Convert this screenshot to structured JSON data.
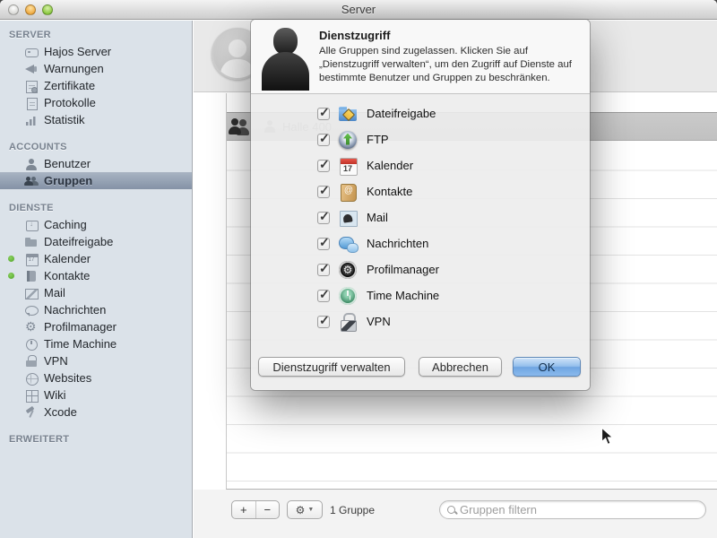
{
  "colors": {
    "sidebar_selection": "#8492a6",
    "ok_button_blue": "#7fb2e8",
    "status_green": "#4ea327",
    "row_selected_gray": "#c5c5c5"
  },
  "window": {
    "title": "Server"
  },
  "sidebar": {
    "sections": {
      "server": {
        "label": "SERVER"
      },
      "accounts": {
        "label": "ACCOUNTS"
      },
      "dienste": {
        "label": "DIENSTE"
      },
      "erweitert": {
        "label": "ERWEITERT"
      }
    },
    "server_items": [
      {
        "label": "Hajos Server",
        "icon": "server"
      },
      {
        "label": "Warnungen",
        "icon": "megaphone"
      },
      {
        "label": "Zertifikate",
        "icon": "certificate"
      },
      {
        "label": "Protokolle",
        "icon": "document"
      },
      {
        "label": "Statistik",
        "icon": "chart"
      }
    ],
    "accounts_items": [
      {
        "label": "Benutzer",
        "icon": "user"
      },
      {
        "label": "Gruppen",
        "icon": "users",
        "selected": "true"
      }
    ],
    "dienste_items": [
      {
        "label": "Caching",
        "icon": "caching"
      },
      {
        "label": "Dateifreigabe",
        "icon": "folder"
      },
      {
        "label": "Kalender",
        "icon": "calendar-s",
        "dot": "on"
      },
      {
        "label": "Kontakte",
        "icon": "contacts-s",
        "dot": "on"
      },
      {
        "label": "Mail",
        "icon": "mail-s"
      },
      {
        "label": "Nachrichten",
        "icon": "chat-s"
      },
      {
        "label": "Profilmanager",
        "icon": "profile-s"
      },
      {
        "label": "Time Machine",
        "icon": "tm-s"
      },
      {
        "label": "VPN",
        "icon": "lock-s"
      },
      {
        "label": "Websites",
        "icon": "globe-s"
      },
      {
        "label": "Wiki",
        "icon": "wiki-s"
      },
      {
        "label": "Xcode",
        "icon": "hammer-s"
      }
    ]
  },
  "content": {
    "selected_group": {
      "name": "Halle 400"
    },
    "toolbar": {
      "add_label": "+",
      "remove_label": "−",
      "gear_label": "⚙",
      "gear_caret": "▼",
      "count_label": "1 Gruppe",
      "filter_placeholder": "Gruppen filtern"
    }
  },
  "popover": {
    "title": "Dienstzugriff",
    "description": "Alle Gruppen sind zugelassen. Klicken Sie auf „Dienstzugriff verwalten“, um den Zugriff auf Dienste auf bestimmte Benutzer und Gruppen zu beschränken.",
    "services": [
      {
        "name": "Dateifreigabe",
        "icon": "fileshare",
        "checked": "true"
      },
      {
        "name": "FTP",
        "icon": "ftp",
        "checked": "true"
      },
      {
        "name": "Kalender",
        "icon": "calendar",
        "checked": "true"
      },
      {
        "name": "Kontakte",
        "icon": "contacts",
        "checked": "true"
      },
      {
        "name": "Mail",
        "icon": "mail",
        "checked": "true"
      },
      {
        "name": "Nachrichten",
        "icon": "messages",
        "checked": "true"
      },
      {
        "name": "Profilmanager",
        "icon": "profilemanager",
        "checked": "true"
      },
      {
        "name": "Time Machine",
        "icon": "timemachine",
        "checked": "true"
      },
      {
        "name": "VPN",
        "icon": "vpn",
        "checked": "true"
      }
    ],
    "buttons": {
      "manage": "Dienstzugriff verwalten",
      "cancel": "Abbrechen",
      "ok": "OK"
    }
  }
}
